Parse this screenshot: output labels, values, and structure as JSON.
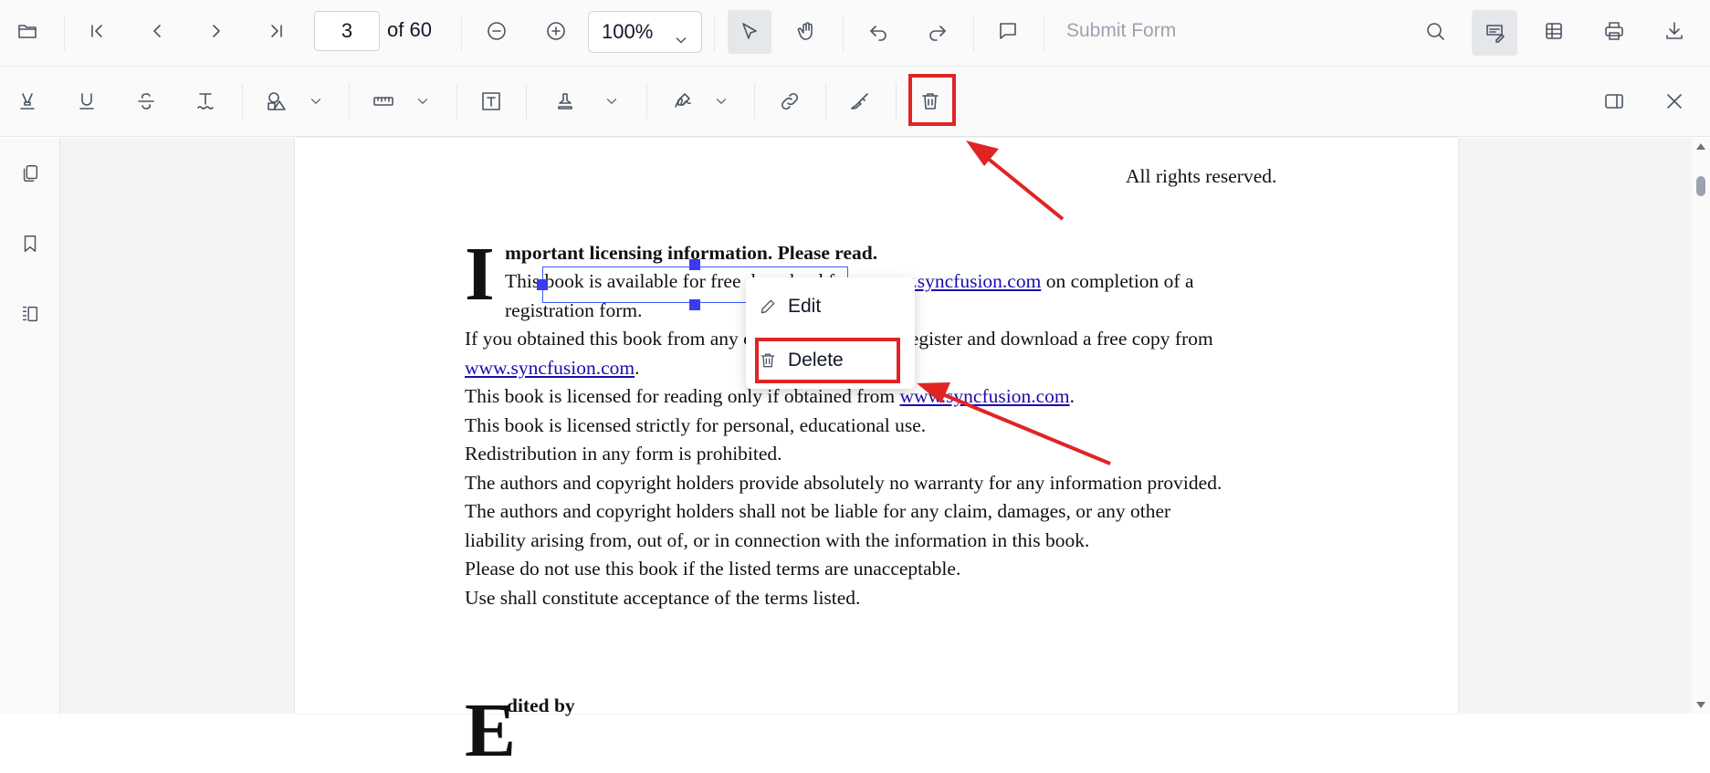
{
  "toolbar": {
    "page_current": "3",
    "page_of": "of 60",
    "zoom": "100%",
    "submit_form": "Submit Form"
  },
  "context_menu": {
    "edit": "Edit",
    "delete": "Delete"
  },
  "document": {
    "rights": "All rights reserved.",
    "dropcap": "I",
    "heading": "mportant licensing information. Please read.",
    "line1_a": "This book is available for free download from ",
    "line1_link": "www.syncfusion.com",
    "line1_b": " on completion of a",
    "line2": "registration form.",
    "line3": "If you obtained this book from any other source, please register and download a free copy from",
    "line4_link": "www.syncfusion.com",
    "line4_b": ".",
    "line5_a": "This book is licensed for reading only if obtained from ",
    "line5_link": "www.syncfusion.com",
    "line5_b": ".",
    "line6": "This book is licensed strictly for personal, educational use.",
    "line7": "Redistribution in any form is prohibited.",
    "line8": "The authors and copyright holders provide absolutely no warranty for any information provided.",
    "line9": "The authors and copyright holders shall not be liable for any claim, damages, or any other",
    "line10": "liability arising from, out of, or in connection with the information in this book.",
    "line11": "Please do not use this book if the listed terms are unacceptable.",
    "line12": "Use shall constitute acceptance of the terms listed.",
    "dropcap2": "E",
    "edited_by": "dited by"
  },
  "colors": {
    "highlight": "#e02424",
    "selection": "#3b5bfd",
    "link": "#1a0dab"
  },
  "icons": {
    "toolbar1": [
      "folder-icon",
      "first-page-icon",
      "previous-page-icon",
      "next-page-icon",
      "last-page-icon",
      "zoom-out-icon",
      "zoom-in-icon",
      "chevron-down-icon",
      "select-pointer-icon",
      "pan-hand-icon",
      "undo-icon",
      "redo-icon",
      "comment-icon",
      "search-icon",
      "annotation-edit-icon",
      "form-fields-icon",
      "print-icon",
      "download-icon"
    ],
    "toolbar2": [
      "highlight-icon",
      "underline-icon",
      "strikethrough-icon",
      "squiggly-icon",
      "shapes-icon",
      "measure-icon",
      "free-text-icon",
      "stamp-icon",
      "signature-icon",
      "link-icon",
      "ink-icon",
      "delete-icon",
      "panel-icon",
      "close-icon"
    ],
    "sidebar": [
      "page-thumbnails-icon",
      "bookmark-icon",
      "page-organizer-icon"
    ]
  }
}
